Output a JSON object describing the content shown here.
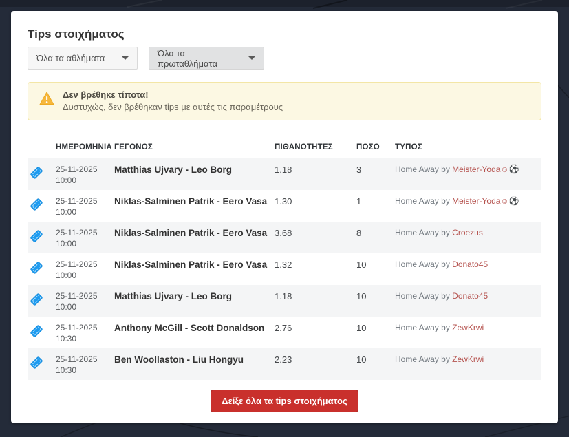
{
  "page": {
    "title": "Tips στοιχήματος"
  },
  "filters": {
    "sport": {
      "value": "Όλα τα αθλήματα"
    },
    "league": {
      "value": "Όλα τα πρωταθλήματα"
    }
  },
  "alert": {
    "title": "Δεν βρέθηκε τίποτα!",
    "message": "Δυστυχώς, δεν βρέθηκαν tips με αυτές τις παραμέτρους"
  },
  "table": {
    "headers": [
      "ΗΜΕΡΟΜΗΝΙΑ",
      "ΓΕΓΟΝΟΣ",
      "ΠΙΘΑΝΟΤΗΤΕΣ",
      "ΠΟΣΟ",
      "ΤΥΠΟΣ"
    ],
    "rows": [
      {
        "date": "25-11-2025",
        "time": "10:00",
        "event": "Matthias Ujvary - Leo Borg",
        "odds": "1.18",
        "amount": "3",
        "type_prefix": "Home Away by ",
        "tipster": "Meister-Yoda☺⚽"
      },
      {
        "date": "25-11-2025",
        "time": "10:00",
        "event": "Niklas-Salminen Patrik - Eero Vasa",
        "odds": "1.30",
        "amount": "1",
        "type_prefix": "Home Away by ",
        "tipster": "Meister-Yoda☺⚽"
      },
      {
        "date": "25-11-2025",
        "time": "10:00",
        "event": "Niklas-Salminen Patrik - Eero Vasa",
        "odds": "3.68",
        "amount": "8",
        "type_prefix": "Home Away by ",
        "tipster": "Croezus"
      },
      {
        "date": "25-11-2025",
        "time": "10:00",
        "event": "Niklas-Salminen Patrik - Eero Vasa",
        "odds": "1.32",
        "amount": "10",
        "type_prefix": "Home Away by ",
        "tipster": "Donato45"
      },
      {
        "date": "25-11-2025",
        "time": "10:00",
        "event": "Matthias Ujvary - Leo Borg",
        "odds": "1.18",
        "amount": "10",
        "type_prefix": "Home Away by ",
        "tipster": "Donato45"
      },
      {
        "date": "25-11-2025",
        "time": "10:30",
        "event": "Anthony McGill - Scott Donaldson",
        "odds": "2.76",
        "amount": "10",
        "type_prefix": "Home Away by ",
        "tipster": "ZewKrwi"
      },
      {
        "date": "25-11-2025",
        "time": "10:30",
        "event": "Ben Woollaston - Liu Hongyu",
        "odds": "2.23",
        "amount": "10",
        "type_prefix": "Home Away by ",
        "tipster": "ZewKrwi"
      }
    ]
  },
  "footer": {
    "show_all_label": "Δείξε όλα τα tips στοιχήματος"
  },
  "icons": {
    "row_icon": "ticket-icon",
    "alert_icon": "warning-triangle-icon",
    "dropdown_icon": "caret-down-icon"
  },
  "colors": {
    "page_bg": "#242b39",
    "card_bg": "#ffffff",
    "accent_red": "#c9302c",
    "tipster_link_red": "#b5524e",
    "ticket_blue": "#1d9bf0",
    "alert_bg": "#fcf8e3",
    "alert_border": "#f3e6a6",
    "row_stripe": "#f4f5f6"
  }
}
